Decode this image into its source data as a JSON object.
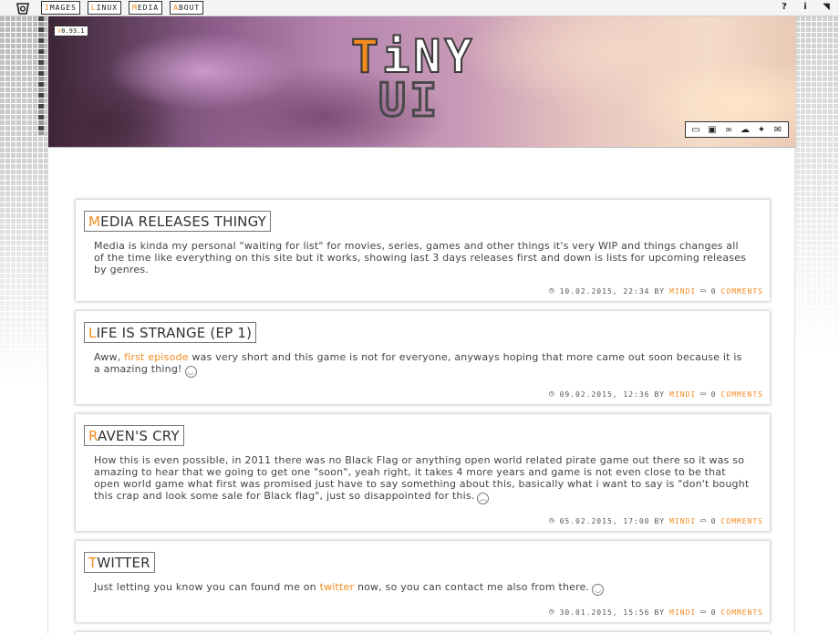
{
  "topbar": {
    "logo_icon": "tinyui-logo-icon",
    "nav": [
      {
        "first": "I",
        "rest": "MAGES"
      },
      {
        "first": "L",
        "rest": "INUX"
      },
      {
        "first": "M",
        "rest": "EDIA"
      },
      {
        "first": "A",
        "rest": "BOUT"
      }
    ],
    "right_icons": [
      {
        "name": "help-icon",
        "glyph": "?"
      },
      {
        "name": "info-icon",
        "glyph": "i"
      },
      {
        "name": "rss-icon",
        "glyph": "◥"
      }
    ]
  },
  "header": {
    "version_v": "V",
    "version_rest": "0.93.1",
    "brand_t": "T",
    "brand_rest": "iNY",
    "brand_line2": "UI",
    "social": [
      {
        "name": "chat-icon",
        "glyph": "▭"
      },
      {
        "name": "youtube-icon",
        "glyph": "▣"
      },
      {
        "name": "steam-icon",
        "glyph": "∞"
      },
      {
        "name": "soundcloud-icon",
        "glyph": "☁"
      },
      {
        "name": "twitter-icon",
        "glyph": "✦"
      },
      {
        "name": "mail-icon",
        "glyph": "✉"
      }
    ]
  },
  "accent_color": "#f38a1e",
  "posts": [
    {
      "title_first": "M",
      "title_rest": "EDIA RELEASES THINGY",
      "body_pre": "Media is kinda my personal \"waiting for list\" for movies, series, games and other things it's very WIP and things changes all of the time like everything on this site but it works, showing last 3 days releases first and down is lists for upcoming releases by genres.",
      "date": "10.02.2015, 22:34",
      "by": "BY",
      "author": "MINDI",
      "comments_count": "0",
      "comments_label": "COMMENTS"
    },
    {
      "title_first": "L",
      "title_rest": "IFE IS STRANGE (EP 1)",
      "body_pre": "Aww, ",
      "body_link": "first episode",
      "body_post": " was very short and this game is not for everyone, anyways hoping that more came out soon because it is a amazing thing!",
      "smiley": "◡",
      "date": "09.02.2015, 12:36",
      "by": "BY",
      "author": "MINDI",
      "comments_count": "0",
      "comments_label": "COMMENTS"
    },
    {
      "title_first": "R",
      "title_rest": "AVEN'S CRY",
      "body_pre": "How this is even possible, in 2011 there was no Black Flag or anything open world related pirate game out there so it was so amazing to hear that we going to get one \"soon\", yeah right, it takes 4 more years and game is not even close to be that open world game what first was promised just have to say something about this, basically what i want to say is \"don't bought this crap and look some sale for Black flag\", just so disappointed for this.",
      "smiley": "︵",
      "date": "05.02.2015, 17:00",
      "by": "BY",
      "author": "MINDI",
      "comments_count": "0",
      "comments_label": "COMMENTS"
    },
    {
      "title_first": "T",
      "title_rest": "WITTER",
      "body_pre": "Just letting you know you can found me on ",
      "body_link": "twitter",
      "body_post": " now, so you can contact me also from there.",
      "smiley": "◡",
      "date": "30.01.2015, 15:56",
      "by": "BY",
      "author": "MINDI",
      "comments_count": "0",
      "comments_label": "COMMENTS"
    }
  ]
}
